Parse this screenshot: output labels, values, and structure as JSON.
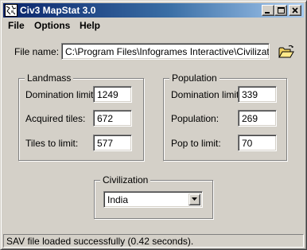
{
  "window": {
    "title": "Civ3 MapStat 3.0",
    "controls": {
      "minimize_icon": "minimize-icon",
      "maximize_icon": "maximize-icon",
      "close_icon": "close-icon"
    }
  },
  "menu": {
    "items": [
      {
        "label": "File"
      },
      {
        "label": "Options"
      },
      {
        "label": "Help"
      }
    ]
  },
  "file": {
    "label": "File name:",
    "value": "C:\\Program Files\\Infogrames Interactive\\Civilization III",
    "browse_icon": "open-folder-icon"
  },
  "landmass": {
    "title": "Landmass",
    "rows": [
      {
        "label": "Domination limit:",
        "value": "1249"
      },
      {
        "label": "Acquired tiles:",
        "value": "672"
      },
      {
        "label": "Tiles to limit:",
        "value": "577"
      }
    ]
  },
  "population": {
    "title": "Population",
    "rows": [
      {
        "label": "Domination limit:",
        "value": "339"
      },
      {
        "label": "Population:",
        "value": "269"
      },
      {
        "label": "Pop to limit:",
        "value": "70"
      }
    ]
  },
  "civilization": {
    "title": "Civilization",
    "selected": "India"
  },
  "status": {
    "text": "SAV file loaded successfully (0.42 seconds)."
  },
  "colors": {
    "face": "#d4d0c8",
    "title_gradient_start": "#0a246a",
    "title_gradient_end": "#a6caf0"
  }
}
